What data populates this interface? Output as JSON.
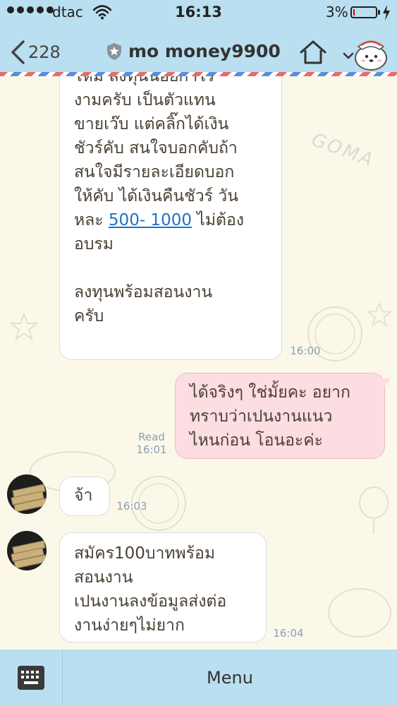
{
  "status_bar": {
    "carrier": "dtac",
    "time": "16:13",
    "battery": "3%"
  },
  "header": {
    "back_count": "228",
    "title": "mo money9900"
  },
  "messages": [
    {
      "lines": [
        "ไหม่ ลงทุนน้อยกำไร",
        "งามครับ เป็นตัวแทน",
        "ขายเว๊บ แต่คลิ๊กได้เงิน",
        "ชัวร์คับ สนใจบอกคับถ้า",
        "สนใจมีรายละเอียดบอก",
        "ให้คับ ได้เงินคืนชัวร์ วัน"
      ],
      "link_prefix": "หละ ",
      "link_text": "500- 1000",
      "link_suffix": " ไม่ต้อง",
      "lines_after": [
        "อบรม",
        "",
        "ลงทุนพร้อมสอนงาน",
        "ครับ"
      ],
      "time": "16:00"
    },
    {
      "lines": [
        "ได้จริงๆ ใช่มั้ยคะ อยาก",
        "ทราบว่าเปนงานแนว",
        "ไหนก่อน โอนอะค่ะ"
      ],
      "read": "Read",
      "time": "16:01"
    },
    {
      "text": "จ้า",
      "time": "16:03"
    },
    {
      "lines": [
        "สมัคร100บาทพร้อม",
        "สอนงาน",
        "เปนงานลงข้อมูลส่งต่อ",
        "งานง่ายๆไม่ยาก"
      ],
      "time": "16:04"
    }
  ],
  "background": {
    "watermark": "GOMA"
  },
  "bottom_bar": {
    "menu_label": "Menu"
  }
}
